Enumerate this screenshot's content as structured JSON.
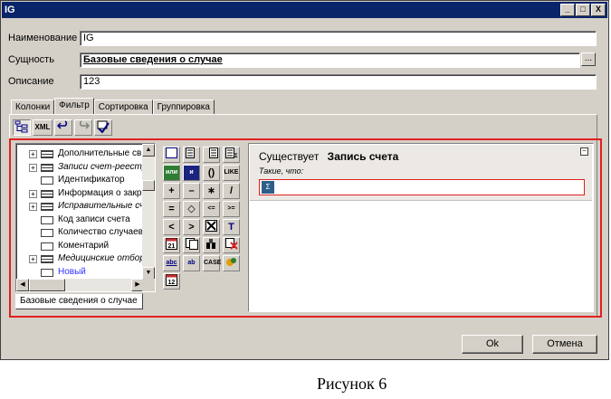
{
  "window": {
    "title": "IG",
    "controls": [
      "_",
      "□",
      "X"
    ]
  },
  "form": {
    "name_label": "Наименование",
    "name_value": "IG",
    "entity_label": "Сущность",
    "entity_value": "Базовые сведения о случае",
    "entity_button": "...",
    "description_label": "Описание",
    "description_value": "123"
  },
  "tabs": [
    "Колонки",
    "Фильтр",
    "Сортировка",
    "Группировка"
  ],
  "active_tab": "Фильтр",
  "toolbar": {
    "xml_label": "XML"
  },
  "tree": {
    "items": [
      {
        "label": "Дополнительные св",
        "expandable": true,
        "style": "normal",
        "icon": "table-multi-icon"
      },
      {
        "label": "Записи счет-реестр",
        "expandable": true,
        "style": "italic",
        "icon": "table-multi-icon"
      },
      {
        "label": "Идентификатор",
        "expandable": false,
        "style": "normal",
        "icon": "field-icon"
      },
      {
        "label": "Информация о закр",
        "expandable": true,
        "style": "normal",
        "icon": "table-multi-icon"
      },
      {
        "label": "Исправительные сч",
        "expandable": true,
        "style": "italic",
        "icon": "table-multi-icon"
      },
      {
        "label": "Код записи счета",
        "expandable": false,
        "style": "normal",
        "icon": "field-icon"
      },
      {
        "label": "Количество случаев",
        "expandable": false,
        "style": "normal",
        "icon": "field-icon"
      },
      {
        "label": "Коментарий",
        "expandable": false,
        "style": "normal",
        "icon": "field-icon"
      },
      {
        "label": "Медицинские отбор",
        "expandable": true,
        "style": "italic",
        "icon": "table-multi-icon"
      },
      {
        "label": "Новый",
        "expandable": false,
        "style": "blue",
        "icon": "field-icon"
      }
    ],
    "source_tab": "Базовые сведения о случае"
  },
  "palette": {
    "rows": [
      [
        "",
        "",
        "",
        ""
      ],
      [
        "или",
        "и",
        "()",
        "LIKE"
      ],
      [
        "+",
        "–",
        "∗",
        "/"
      ],
      [
        "=",
        "◇",
        "<=",
        ">="
      ],
      [
        "<",
        ">",
        "",
        "T"
      ],
      [
        "",
        "",
        "",
        ""
      ],
      [
        "abc",
        "ab",
        "CASE",
        ""
      ],
      [
        "",
        "",
        "",
        ""
      ]
    ]
  },
  "editor": {
    "exists_label": "Существует",
    "entity_label": "Запись счета",
    "such_that_label": "Такие, что:",
    "input_icon": "Σ",
    "minimize": "–"
  },
  "buttons": {
    "ok": "Ok",
    "cancel": "Отмена"
  },
  "caption": "Рисунок 6"
}
